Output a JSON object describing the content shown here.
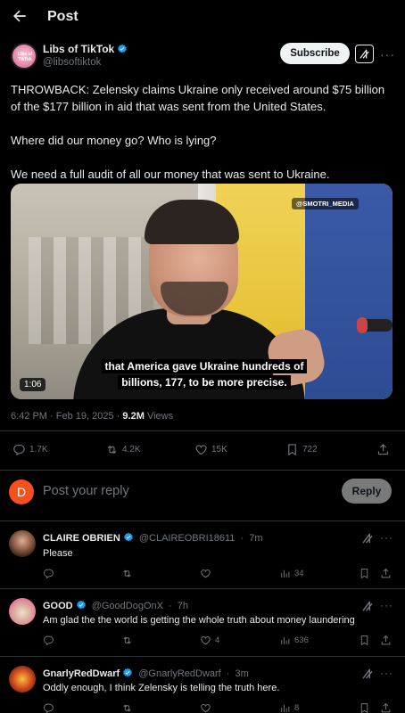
{
  "header": {
    "title": "Post",
    "back_icon": "arrow-left-icon"
  },
  "author": {
    "name": "Libs of TikTok",
    "handle": "@libsoftiktok",
    "avatar_text": "Libs of TikTok",
    "subscribe_label": "Subscribe",
    "verified_color": "#1d9bf0"
  },
  "post": {
    "paragraphs": [
      "THROWBACK: Zelensky claims Ukraine only received around $75 billion of the $177 billion in aid that was sent from the United States.",
      "Where did our money go? Who is lying?",
      "We need a full audit of all our money that was sent to Ukraine."
    ],
    "media": {
      "watermark": "@SMOTRI_MEDIA",
      "caption": "that America gave Ukraine hundreds of billions, 177, to be more precise.",
      "duration": "1:06"
    },
    "time": "6:42 PM",
    "date": "Feb 19, 2025",
    "views_count": "9.2M",
    "views_label": "Views",
    "stats": {
      "replies": "1.7K",
      "reposts": "4.2K",
      "likes": "15K",
      "bookmarks": "722"
    }
  },
  "reply_box": {
    "avatar_letter": "D",
    "placeholder": "Post your reply",
    "button_label": "Reply",
    "avatar_color": "#f4511e"
  },
  "comments": [
    {
      "name": "CLAIRE OBRIEN",
      "handle": "@CLAIREOBRI18611",
      "time": "7m",
      "text": "Please",
      "stats": {
        "replies": "",
        "reposts": "",
        "likes": "",
        "views": "34"
      }
    },
    {
      "name": "GOOD",
      "handle": "@GoodDogOnX",
      "time": "7h",
      "text": "Am glad the the world is getting the whole truth about money laundering",
      "stats": {
        "replies": "",
        "reposts": "",
        "likes": "4",
        "views": "636"
      }
    },
    {
      "name": "GnarlyRedDwarf",
      "handle": "@GnarlyRedDwarf",
      "time": "3m",
      "text": "Oddly enough, I think Zelensky is telling the truth here.",
      "stats": {
        "replies": "",
        "reposts": "",
        "likes": "",
        "views": "8"
      }
    }
  ],
  "separators": {
    "meta": "·",
    "handle": "·"
  }
}
